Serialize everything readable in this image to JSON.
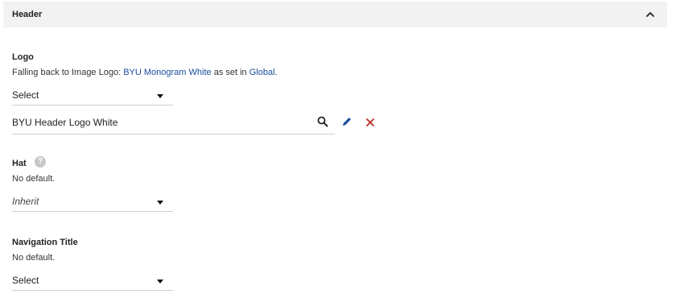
{
  "panel": {
    "title": "Header"
  },
  "logo": {
    "label": "Logo",
    "help_prefix": "Falling back to Image Logo: ",
    "help_link1": "BYU Monogram White",
    "help_middle": " as set in ",
    "help_link2": "Global",
    "help_suffix": ".",
    "select_value": "Select",
    "entity_value": "BYU Header Logo White"
  },
  "hat": {
    "label": "Hat",
    "help_glyph": "?",
    "help_text": "No default.",
    "select_value": "Inherit"
  },
  "nav_title": {
    "label": "Navigation Title",
    "help_text": "No default.",
    "select_value": "Select"
  },
  "icons": {
    "collapse": "chevron-up-icon",
    "search": "search-icon",
    "edit": "pencil-icon",
    "remove": "close-icon",
    "help": "help-circle-icon"
  },
  "colors": {
    "link": "#1a4c9e",
    "edit_icon": "#1a4c9e",
    "remove_icon": "#b52a2a",
    "header_bg": "#f2f2f2"
  }
}
